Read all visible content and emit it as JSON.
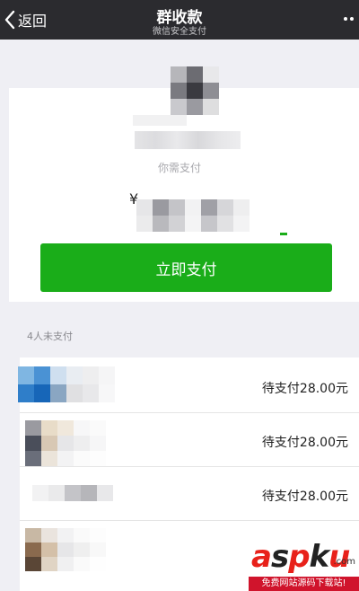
{
  "navbar": {
    "back_label": "返回",
    "title": "群收款",
    "subtitle": "微信安全支付"
  },
  "payment": {
    "need_pay_label": "你需支付",
    "currency": "¥",
    "pay_button_label": "立即支付"
  },
  "unpaid": {
    "header": "4人未支付",
    "rows": [
      {
        "status": "待支付28.00元"
      },
      {
        "status": "待支付28.00元"
      },
      {
        "status": "待支付28.00元"
      }
    ]
  },
  "watermark": {
    "logo": [
      "a",
      "s",
      "p",
      "k",
      "u"
    ],
    "com": ".com",
    "band_text": "免费网站源码下载站!"
  },
  "colors": {
    "navbar_bg": "#2b2b2f",
    "pay_button": "#1aad19",
    "page_bg": "#efeff4"
  }
}
